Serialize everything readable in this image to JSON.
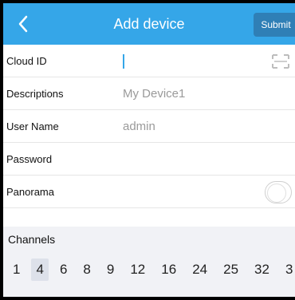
{
  "header": {
    "title": "Add device",
    "submit_label": "Submit"
  },
  "form": {
    "cloud_id": {
      "label": "Cloud ID",
      "value": ""
    },
    "descriptions": {
      "label": "Descriptions",
      "value": "My Device1"
    },
    "user_name": {
      "label": "User Name",
      "value": "admin"
    },
    "password": {
      "label": "Password",
      "value": ""
    },
    "panorama": {
      "label": "Panorama",
      "enabled": false
    }
  },
  "channels": {
    "title": "Channels",
    "options": [
      "1",
      "4",
      "6",
      "8",
      "9",
      "12",
      "16",
      "24",
      "25",
      "32",
      "3"
    ],
    "selected": "4"
  },
  "colors": {
    "header": "#35a6e8",
    "submit": "#2f7fb6",
    "panel": "#f1f2f6"
  }
}
